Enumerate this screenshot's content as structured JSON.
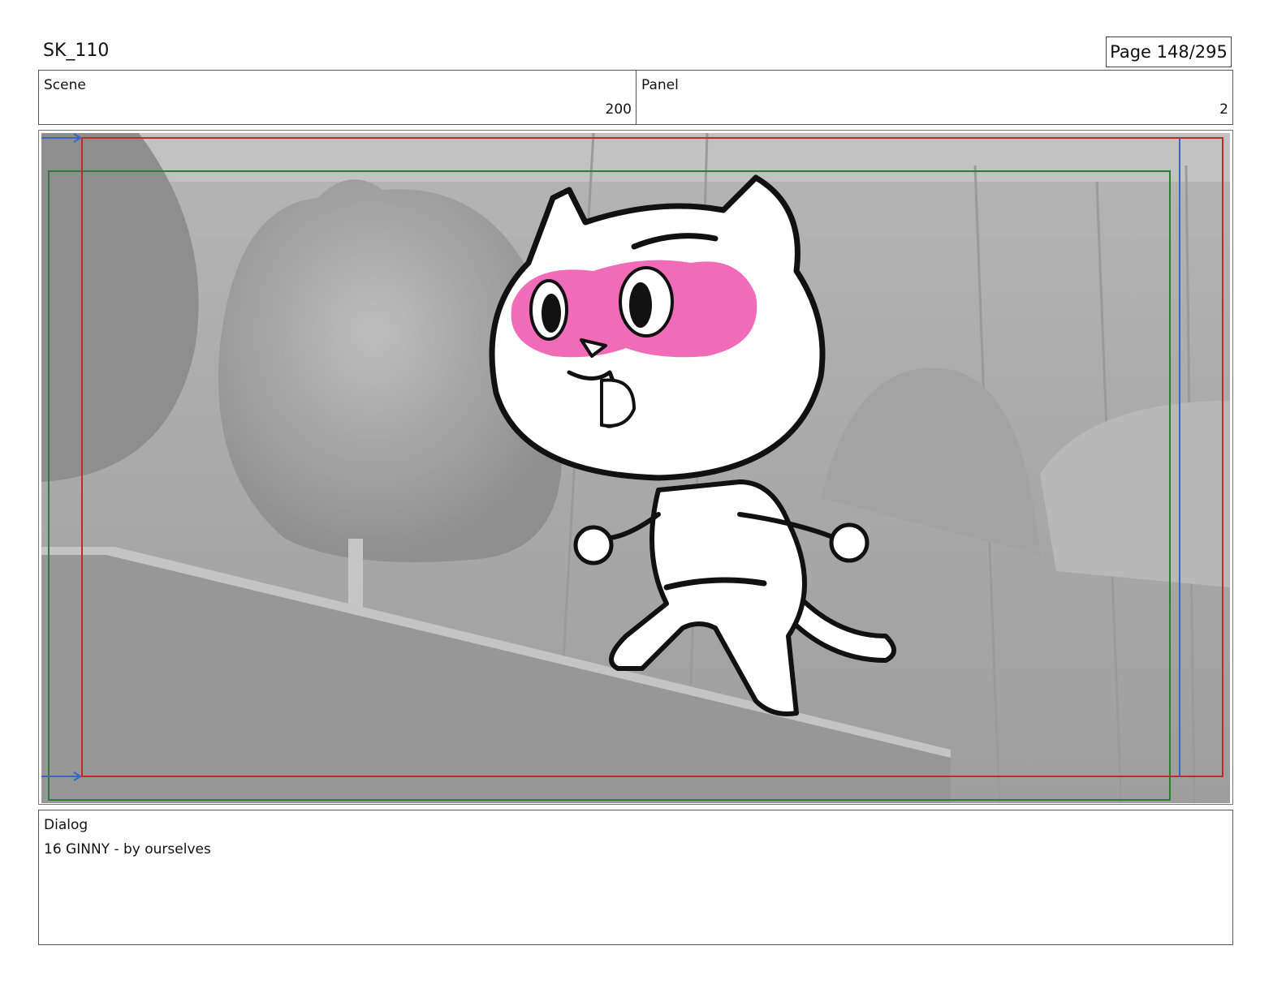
{
  "header": {
    "sequence_id": "SK_110",
    "page_label": "Page 148/295"
  },
  "info": {
    "scene_label": "Scene",
    "scene_value": "200",
    "panel_label": "Panel",
    "panel_value": "2"
  },
  "frame": {
    "safe_area_color": "#2e7d32",
    "action_area_color": "#c62828",
    "camera_guide_color": "#3b63c8",
    "mask_color": "#f06bb8",
    "background_tone": "#a8a8a8"
  },
  "dialog": {
    "label": "Dialog",
    "text": "16 GINNY - by ourselves"
  }
}
